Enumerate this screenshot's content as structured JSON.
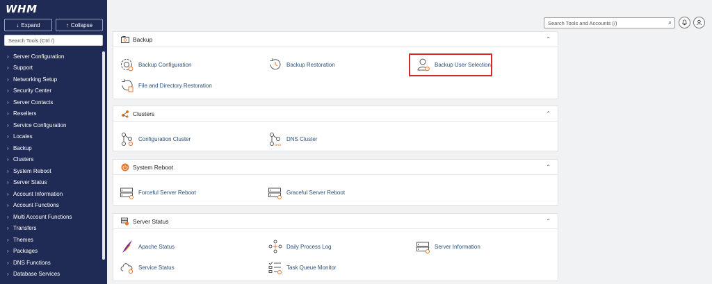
{
  "sidebar": {
    "logo": "WHM",
    "expand_label": "Expand",
    "collapse_label": "Collapse",
    "search_placeholder": "Search Tools (Ctrl /)",
    "items": [
      {
        "label": "Server Configuration"
      },
      {
        "label": "Support"
      },
      {
        "label": "Networking Setup"
      },
      {
        "label": "Security Center"
      },
      {
        "label": "Server Contacts"
      },
      {
        "label": "Resellers"
      },
      {
        "label": "Service Configuration"
      },
      {
        "label": "Locales"
      },
      {
        "label": "Backup"
      },
      {
        "label": "Clusters"
      },
      {
        "label": "System Reboot"
      },
      {
        "label": "Server Status"
      },
      {
        "label": "Account Information"
      },
      {
        "label": "Account Functions"
      },
      {
        "label": "Multi Account Functions"
      },
      {
        "label": "Transfers"
      },
      {
        "label": "Themes"
      },
      {
        "label": "Packages"
      },
      {
        "label": "DNS Functions"
      },
      {
        "label": "Database Services"
      }
    ]
  },
  "header": {
    "search_placeholder": "Search Tools and Accounts (/)"
  },
  "sections": {
    "backup": {
      "title": "Backup",
      "tools": [
        "Backup Configuration",
        "Backup Restoration",
        "Backup User Selection",
        "File and Directory Restoration"
      ]
    },
    "clusters": {
      "title": "Clusters",
      "tools": [
        "Configuration Cluster",
        "DNS Cluster"
      ]
    },
    "system_reboot": {
      "title": "System Reboot",
      "tools": [
        "Forceful Server Reboot",
        "Graceful Server Reboot"
      ]
    },
    "server_status": {
      "title": "Server Status",
      "tools": [
        "Apache Status",
        "Daily Process Log",
        "Server Information",
        "Service Status",
        "Task Queue Monitor"
      ]
    }
  },
  "colors": {
    "sidebar_bg": "#1f2a55",
    "link": "#2a4f7a",
    "accent_orange": "#e8762c",
    "highlight_red": "#d62a2a"
  }
}
